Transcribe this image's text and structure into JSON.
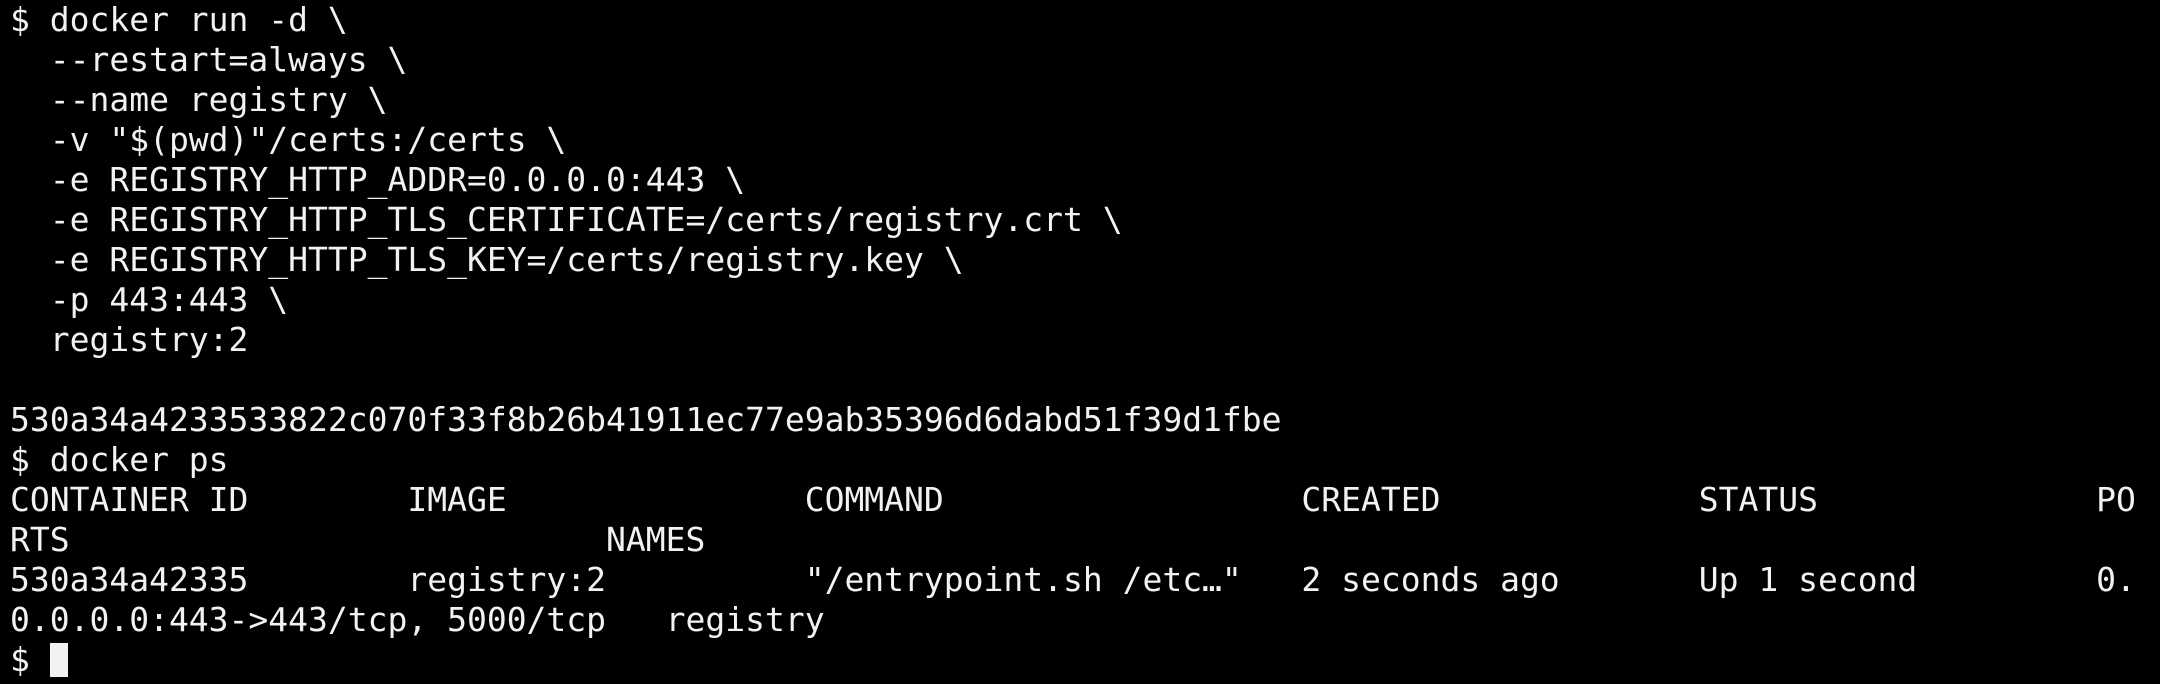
{
  "terminal": {
    "lines": [
      "$ docker run -d \\",
      "  --restart=always \\",
      "  --name registry \\",
      "  -v \"$(pwd)\"/certs:/certs \\",
      "  -e REGISTRY_HTTP_ADDR=0.0.0.0:443 \\",
      "  -e REGISTRY_HTTP_TLS_CERTIFICATE=/certs/registry.crt \\",
      "  -e REGISTRY_HTTP_TLS_KEY=/certs/registry.key \\",
      "  -p 443:443 \\",
      "  registry:2",
      "",
      "530a34a4233533822c070f33f8b26b41911ec77e9ab35396d6dabd51f39d1fbe",
      "$ docker ps",
      "CONTAINER ID        IMAGE               COMMAND                  CREATED             STATUS              PO",
      "RTS                           NAMES",
      "530a34a42335        registry:2          \"/entrypoint.sh /etc…\"   2 seconds ago       Up 1 second         0.",
      "0.0.0.0:443->443/tcp, 5000/tcp   registry"
    ],
    "prompt": "$ "
  },
  "colors": {
    "background": "#000000",
    "foreground": "#f2f2f2"
  }
}
